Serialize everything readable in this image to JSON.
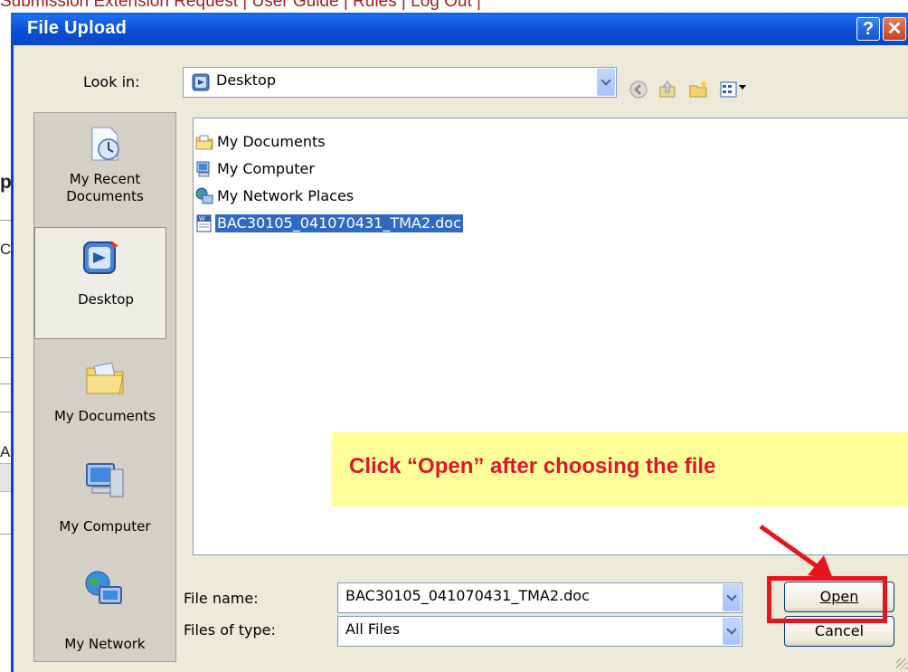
{
  "background_page": {
    "top_nav_text": "Submission Extension Request | User Guide | Rules | Log Out |",
    "fragment_bold_p": "p",
    "fragment_c": "C",
    "fragment_a": "A"
  },
  "dialog": {
    "title": "File Upload",
    "help_button": "?",
    "close_button": "✕",
    "look_in_label": "Look in:",
    "look_in_value": "Desktop",
    "places": [
      {
        "label": "My Recent\nDocuments",
        "icon": "recent-documents-icon"
      },
      {
        "label": "Desktop",
        "icon": "desktop-icon",
        "selected": true
      },
      {
        "label": "My Documents",
        "icon": "my-documents-folder-icon"
      },
      {
        "label": "My Computer",
        "icon": "my-computer-icon"
      },
      {
        "label": "My Network",
        "icon": "my-network-icon"
      }
    ],
    "files": [
      {
        "name": "My Documents",
        "icon": "folder-icon"
      },
      {
        "name": "My Computer",
        "icon": "computer-icon"
      },
      {
        "name": "My Network Places",
        "icon": "network-icon"
      },
      {
        "name": "BAC30105_041070431_TMA2.doc",
        "icon": "word-document-icon",
        "selected": true
      }
    ],
    "file_name_label": "File name:",
    "file_name_value": "BAC30105_041070431_TMA2.doc",
    "files_of_type_label": "Files of type:",
    "files_of_type_value": "All Files",
    "open_button": "Open",
    "cancel_button": "Cancel"
  },
  "annotation": {
    "text": "Click “Open” after choosing the file",
    "text_color": "#e0152b",
    "background": "#ffff99"
  },
  "colors": {
    "titlebar": "#0a4fd4",
    "dialog_face": "#ece9d8",
    "selection": "#316ac5",
    "highlight_box": "#e8141c"
  }
}
